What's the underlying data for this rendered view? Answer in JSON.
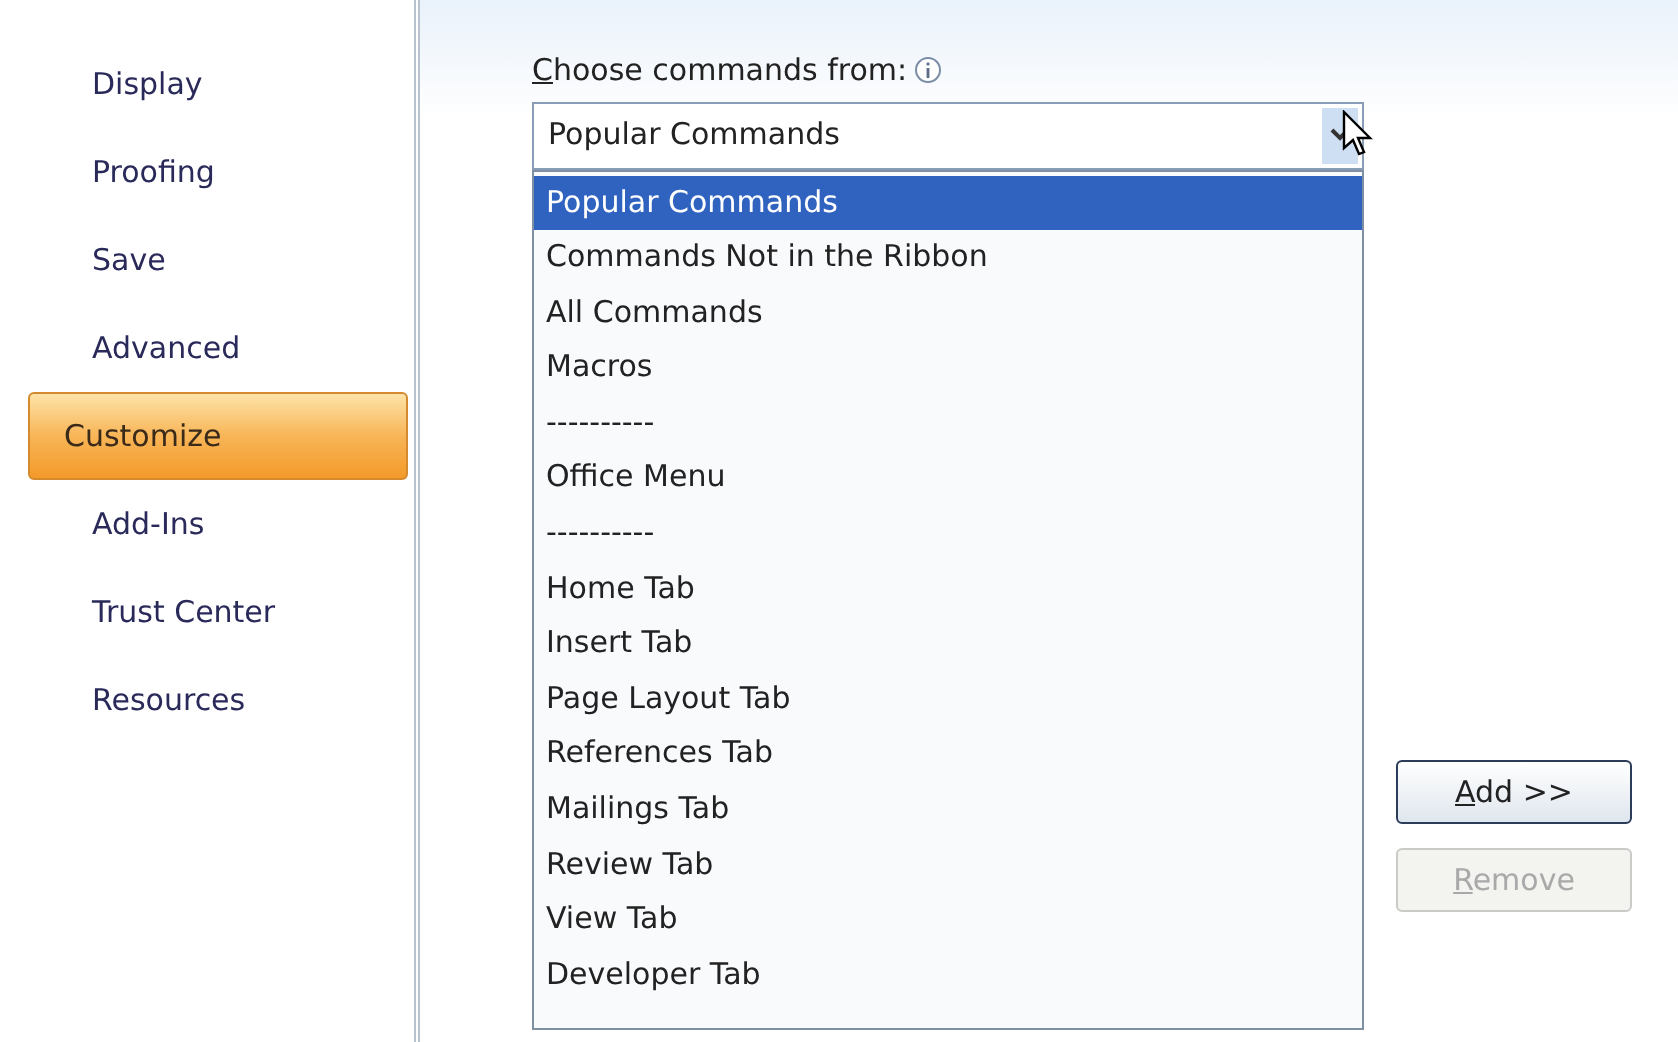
{
  "sidebar": {
    "items": [
      {
        "label": "Display",
        "selected": false
      },
      {
        "label": "Proofing",
        "selected": false
      },
      {
        "label": "Save",
        "selected": false
      },
      {
        "label": "Advanced",
        "selected": false
      },
      {
        "label": "Customize",
        "selected": true
      },
      {
        "label": "Add-Ins",
        "selected": false
      },
      {
        "label": "Trust Center",
        "selected": false
      },
      {
        "label": "Resources",
        "selected": false
      }
    ]
  },
  "commands_from": {
    "label": "Choose commands from:",
    "underline_first": true,
    "value": "Popular Commands",
    "expanded": true,
    "options": [
      {
        "label": "Popular Commands",
        "selected": true
      },
      {
        "label": "Commands Not in the Ribbon",
        "selected": false
      },
      {
        "label": "All Commands",
        "selected": false
      },
      {
        "label": "Macros",
        "selected": false
      },
      {
        "label": "----------",
        "selected": false
      },
      {
        "label": "Office Menu",
        "selected": false
      },
      {
        "label": "----------",
        "selected": false
      },
      {
        "label": "Home Tab",
        "selected": false
      },
      {
        "label": "Insert Tab",
        "selected": false
      },
      {
        "label": "Page Layout Tab",
        "selected": false
      },
      {
        "label": "References Tab",
        "selected": false
      },
      {
        "label": "Mailings Tab",
        "selected": false
      },
      {
        "label": "Review Tab",
        "selected": false
      },
      {
        "label": "View Tab",
        "selected": false
      },
      {
        "label": "Developer Tab",
        "selected": false
      }
    ]
  },
  "buttons": [
    {
      "label": "Add >>",
      "underline_first": true,
      "disabled": false
    },
    {
      "label": "Remove",
      "underline_first": true,
      "disabled": true
    }
  ]
}
